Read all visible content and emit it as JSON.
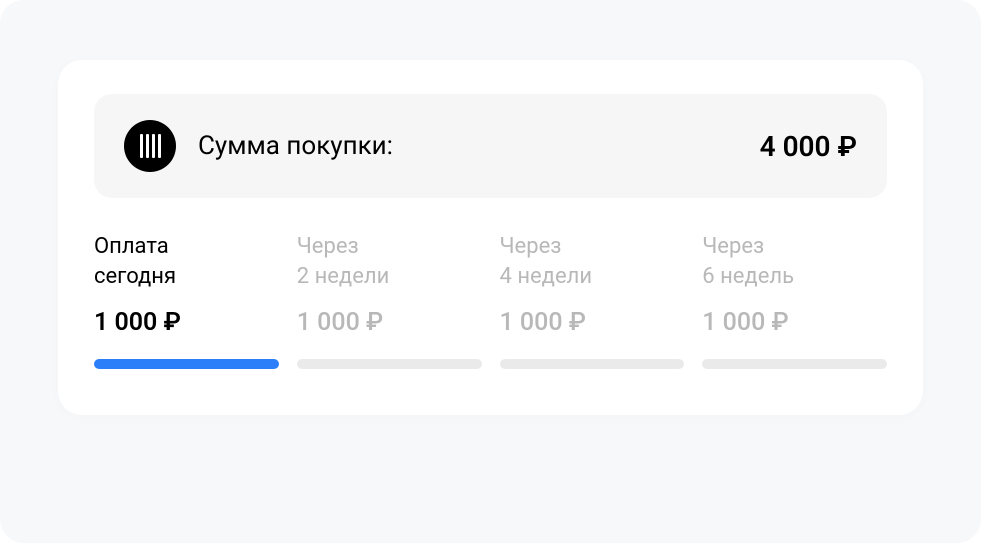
{
  "summary": {
    "label": "Сумма покупки:",
    "amount": "4 000 ₽"
  },
  "installments": [
    {
      "label_line1": "Оплата",
      "label_line2": "сегодня",
      "amount": "1 000 ₽",
      "active": true
    },
    {
      "label_line1": "Через",
      "label_line2": "2 недели",
      "amount": "1 000 ₽",
      "active": false
    },
    {
      "label_line1": "Через",
      "label_line2": "4 недели",
      "amount": "1 000 ₽",
      "active": false
    },
    {
      "label_line1": "Через",
      "label_line2": "6 недель",
      "amount": "1 000 ₽",
      "active": false
    }
  ],
  "colors": {
    "accent": "#2d7ff9",
    "inactive_bar": "#eaeaea",
    "inactive_text": "#b8b8b8"
  }
}
